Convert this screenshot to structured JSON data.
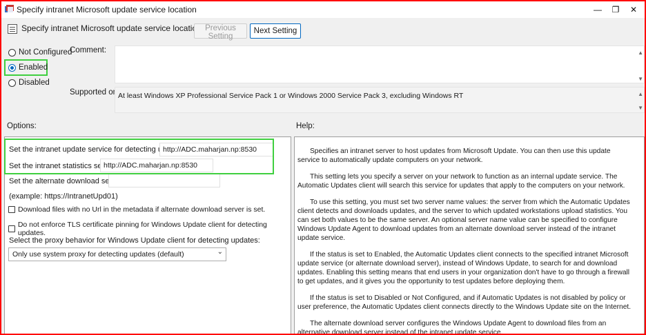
{
  "window": {
    "title": "Specify intranet Microsoft update service location",
    "controls": {
      "restore": "❐",
      "close": "✕"
    }
  },
  "header": {
    "title": "Specify intranet Microsoft update service location",
    "prev_button": "Previous Setting",
    "next_button": "Next Setting"
  },
  "state": {
    "options": [
      "Not Configured",
      "Enabled",
      "Disabled"
    ],
    "selected": "Enabled"
  },
  "comment": {
    "label": "Comment:",
    "value": ""
  },
  "supported_on": {
    "label": "Supported on:",
    "value": "At least Windows XP Professional Service Pack 1 or Windows 2000 Service Pack 3, excluding Windows RT"
  },
  "sections": {
    "options": "Options:",
    "help": "Help:"
  },
  "options": {
    "detect_label": "Set the intranet update service for detecting updates:",
    "detect_value": "http://ADC.maharjan.np:8530",
    "stats_label": "Set the intranet statistics server:",
    "stats_value": "http://ADC.maharjan.np:8530",
    "alt_label": "Set the alternate download server:",
    "alt_value": "",
    "example": "(example: https://IntranetUpd01)",
    "check_no_url": "Download files with no Url in the metadata if alternate download server is set.",
    "check_tls": "Do not enforce TLS certificate pinning for Windows Update client for detecting updates.",
    "proxy_label": "Select the proxy behavior for Windows Update client for detecting updates:",
    "proxy_value": "Only use system proxy for detecting updates (default)"
  },
  "help": {
    "paragraphs": [
      "Specifies an intranet server to host updates from Microsoft Update. You can then use this update service to automatically update computers on your network.",
      "This setting lets you specify a server on your network to function as an internal update service. The Automatic Updates client will search this service for updates that apply to the computers on your network.",
      "To use this setting, you must set two server name values: the server from which the Automatic Updates client detects and downloads updates, and the server to which updated workstations upload statistics. You can set both values to be the same server. An optional server name value can be specified to configure Windows Update Agent to download updates from an alternate download server instead of the intranet update service.",
      "If the status is set to Enabled, the Automatic Updates client connects to the specified intranet Microsoft update service (or alternate download server), instead of Windows Update, to search for and download updates. Enabling this setting means that end users in your organization don't have to go through a firewall to get updates, and it gives you the opportunity to test updates before deploying them.",
      "If the status is set to Disabled or Not Configured, and if Automatic Updates is not disabled by policy or user preference, the Automatic Updates client connects directly to the Windows Update site on the Internet.",
      "The alternate download server configures the Windows Update Agent to download files from an alternative download server instead of the intranet update service."
    ]
  },
  "colors": {
    "highlight": "#3fcf3f",
    "frame": "#ff0000",
    "accent": "#0067c0"
  }
}
